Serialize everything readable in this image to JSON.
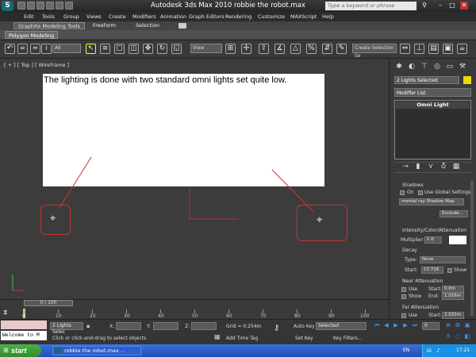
{
  "window": {
    "title": "Autodesk 3ds Max  2010       robbie the robot.max",
    "search_placeholder": "Type a keyword or phrase",
    "minimize": "–",
    "maximize": "□",
    "close": "✕"
  },
  "menu": [
    "Edit",
    "Tools",
    "Group",
    "Views",
    "Create",
    "Modifiers",
    "Animation",
    "Graph Editors",
    "Rendering",
    "Customize",
    "MAXScript",
    "Help"
  ],
  "ribbon": {
    "tabs": [
      "Graphite Modeling Tools",
      "Freeform",
      "Selection"
    ],
    "sub_tab": "Polygon Modeling"
  },
  "toolbar": {
    "filter": "All",
    "coord_system": "View",
    "named_selection": "Create Selection Se"
  },
  "viewport": {
    "label": "[ + ] [ Top ] [ Wireframe ]",
    "note": "The lighting is done with two standard omni lights set quite low."
  },
  "command_panel": {
    "object_name": "2 Lights Selected",
    "object_color": "#e8d800",
    "modifier_list": "Modifier List",
    "stack_item": "Omni Light",
    "shadows": {
      "title": "Shadows",
      "on_label": "On",
      "global_label": "Use Global Settings",
      "type": "mental ray Shadow Map",
      "exclude": "Exclude..."
    },
    "intensity": {
      "title": "Intensity/Color/Attenuation",
      "multiplier_label": "Multiplier:",
      "multiplier": "1.0",
      "decay_title": "Decay",
      "type_label": "Type:",
      "type": "None",
      "start_label": "Start:",
      "start": "13.716",
      "show_label": "Show"
    },
    "near": {
      "title": "Near Attenuation",
      "use_label": "Use",
      "show_label": "Show",
      "start_label": "Start:",
      "start": "0.0m",
      "end_label": "End:",
      "end": "1.016m"
    },
    "far": {
      "title": "Far Attenuation",
      "use_label": "Use",
      "start_label": "Start:",
      "start": "2.032m"
    }
  },
  "timeline": {
    "slider": "0 / 100",
    "ticks": [
      "0",
      "10",
      "20",
      "30",
      "40",
      "50",
      "60",
      "70",
      "80",
      "90",
      "100"
    ]
  },
  "status": {
    "welcome": "Welcome to M",
    "selection": "2 Lights Selec",
    "x_label": "X:",
    "y_label": "Y:",
    "z_label": "Z:",
    "grid": "Grid = 0.254m",
    "prompt": "Click or click-and-drag to select objects",
    "add_time_tag": "Add Time Tag",
    "auto_key": "Auto Key",
    "auto_key_value": "Selected",
    "set_key": "Set Key",
    "key_filters": "Key Filters...",
    "frame": "0"
  },
  "taskbar": {
    "start": "start",
    "task": "robbie the robot.max ...",
    "lang": "EN",
    "time": "17:21"
  }
}
